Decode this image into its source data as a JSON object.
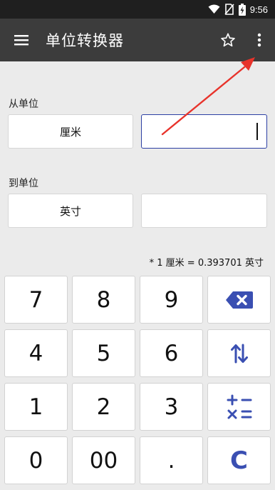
{
  "status_bar": {
    "time": "9:56",
    "icons": [
      "wifi-icon",
      "no-sim-icon",
      "battery-charging-icon"
    ]
  },
  "app_bar": {
    "title": "单位转换器",
    "menu_icon": "hamburger-menu-icon",
    "favorite_icon": "star-outline-icon",
    "overflow_icon": "more-vert-icon"
  },
  "from": {
    "label": "从单位",
    "unit": "厘米",
    "value": ""
  },
  "to": {
    "label": "到单位",
    "unit": "英寸",
    "value": ""
  },
  "conversion_note": "* 1 厘米 = 0.393701 英寸",
  "keypad": {
    "k7": "7",
    "k8": "8",
    "k9": "9",
    "k4": "4",
    "k5": "5",
    "k6": "6",
    "k1": "1",
    "k2": "2",
    "k3": "3",
    "k0": "0",
    "k00": "00",
    "kdot": ".",
    "backspace_icon": "backspace-icon",
    "swap_icon": "swap-vertical-icon",
    "operators_icon": "calculator-operators-icon",
    "clear_label": "C"
  },
  "colors": {
    "status_bar": "#1f1f1f",
    "app_bar": "#3c3c3c",
    "background": "#ebebeb",
    "accent": "#3a4fb2",
    "annotation": "#e8332b"
  }
}
